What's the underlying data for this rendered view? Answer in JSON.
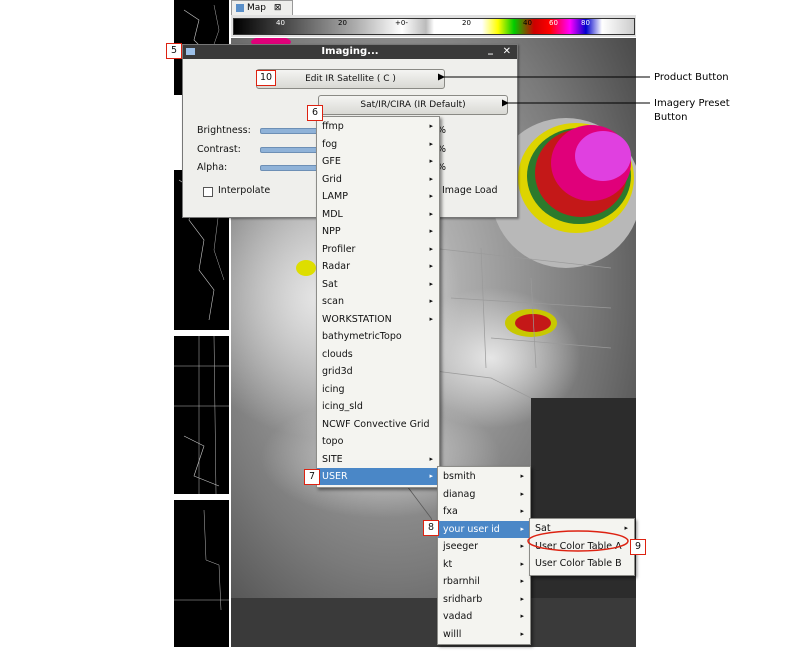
{
  "map_tab": {
    "label": "Map",
    "close": "⊠"
  },
  "colorbar": {
    "ticks": [
      "40",
      "20",
      "+0-",
      "20",
      "40",
      "60",
      "80"
    ],
    "tick_color": "#000000"
  },
  "dialog": {
    "title": "Imaging...",
    "minimize": "_",
    "close": "✕",
    "product_button": "Edit IR Satellite ( C )",
    "preset_button": "Sat/IR/CIRA (IR Default)",
    "brightness_label": "Brightness:",
    "contrast_label": "Contrast:",
    "alpha_label": "Alpha:",
    "interpolate_label": "Interpolate",
    "image_load_label": "Image Load",
    "percent_partial": "%"
  },
  "menu1": {
    "items": [
      {
        "label": "ffmp",
        "submenu": true
      },
      {
        "label": "fog",
        "submenu": true
      },
      {
        "label": "GFE",
        "submenu": true
      },
      {
        "label": "Grid",
        "submenu": true
      },
      {
        "label": "LAMP",
        "submenu": true
      },
      {
        "label": "MDL",
        "submenu": true
      },
      {
        "label": "NPP",
        "submenu": true
      },
      {
        "label": "Profiler",
        "submenu": true
      },
      {
        "label": "Radar",
        "submenu": true
      },
      {
        "label": "Sat",
        "submenu": true
      },
      {
        "label": "scan",
        "submenu": true
      },
      {
        "label": "WORKSTATION",
        "submenu": true
      },
      {
        "label": "bathymetricTopo",
        "submenu": false
      },
      {
        "label": "clouds",
        "submenu": false
      },
      {
        "label": "grid3d",
        "submenu": false
      },
      {
        "label": "icing",
        "submenu": false
      },
      {
        "label": "icing_sld",
        "submenu": false
      },
      {
        "label": "NCWF Convective Grid",
        "submenu": false
      },
      {
        "label": "topo",
        "submenu": false
      },
      {
        "label": "SITE",
        "submenu": true
      },
      {
        "label": "USER",
        "submenu": true,
        "selected": true
      }
    ]
  },
  "menu2": {
    "items": [
      {
        "label": "bsmith",
        "submenu": true
      },
      {
        "label": "dianag",
        "submenu": true
      },
      {
        "label": "fxa",
        "submenu": true
      },
      {
        "label": "your user id",
        "submenu": true,
        "selected": true
      },
      {
        "label": "jseeger",
        "submenu": true
      },
      {
        "label": "kt",
        "submenu": true
      },
      {
        "label": "rbarnhil",
        "submenu": true
      },
      {
        "label": "sridharb",
        "submenu": true
      },
      {
        "label": "vadad",
        "submenu": true
      },
      {
        "label": "willl",
        "submenu": true
      }
    ]
  },
  "menu3": {
    "items": [
      {
        "label": "Sat",
        "submenu": true
      },
      {
        "label": "User Color Table A",
        "submenu": false,
        "circled": true
      },
      {
        "label": "User Color Table B",
        "submenu": false
      }
    ]
  },
  "callouts": {
    "c5": "5",
    "c6": "6",
    "c7": "7",
    "c8": "8",
    "c9": "9",
    "c10": "10"
  },
  "annotations": {
    "product_button": "Product Button",
    "preset_line1": "Imagery Preset",
    "preset_line2": "Button"
  },
  "arrow_glyph": "▸"
}
